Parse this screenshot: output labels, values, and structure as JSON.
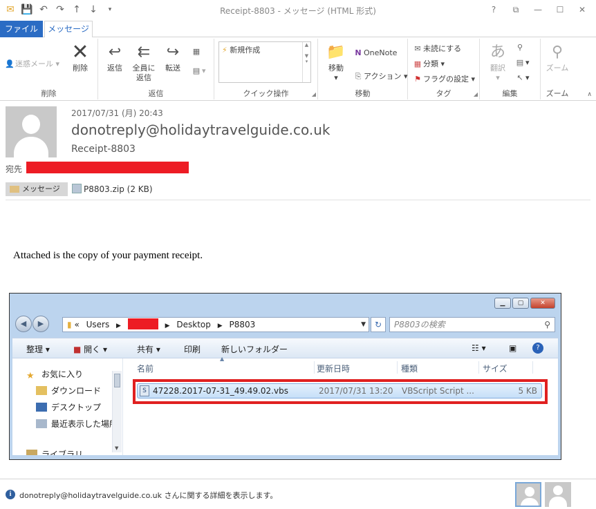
{
  "window": {
    "title": "Receipt-8803 - メッセージ (HTML 形式)",
    "controls": [
      "?",
      "⧉",
      "—",
      "☐",
      "✕"
    ]
  },
  "qat": [
    "mail-icon",
    "save-icon",
    "undo-icon",
    "redo-icon",
    "up-icon",
    "down-icon",
    "customize-icon"
  ],
  "tabs": {
    "file": "ファイル",
    "message": "メッセージ"
  },
  "ribbon": {
    "delete_group": {
      "label": "削除",
      "junk": "迷惑メール",
      "delete": "削除"
    },
    "reply_group": {
      "label": "返信",
      "reply": "返信",
      "reply_all_1": "全員に",
      "reply_all_2": "返信",
      "forward": "転送"
    },
    "quick_group": {
      "label": "クイック操作",
      "new": "新規作成"
    },
    "move_group": {
      "label": "移動",
      "move": "移動",
      "onenote": "OneNote",
      "action": "アクション"
    },
    "tag_group": {
      "label": "タグ",
      "unread": "未読にする",
      "categorize": "分類",
      "flag": "フラグの設定"
    },
    "edit_group": {
      "label": "編集",
      "translate": "翻訳"
    },
    "zoom_group": {
      "label": "ズーム",
      "zoom": "ズーム"
    }
  },
  "message": {
    "date": "2017/07/31 (月) 20:43",
    "sender": "donotreply@holidaytravelguide.co.uk",
    "subject": "Receipt-8803",
    "to_label": "宛先",
    "message_button": "メッセージ",
    "attachment": "P8803.zip (2 KB)",
    "body": "Attached is the copy of your payment receipt."
  },
  "explorer": {
    "breadcrumb": {
      "lead": "«",
      "users": "Users",
      "desktop": "Desktop",
      "folder": "P8803"
    },
    "search_placeholder": "P8803の検索",
    "toolbar": {
      "organize": "整理",
      "open": "開く",
      "share": "共有",
      "print": "印刷",
      "new_folder": "新しいフォルダー"
    },
    "nav": {
      "favorites": "お気に入り",
      "downloads": "ダウンロード",
      "desktop": "デスクトップ",
      "recent": "最近表示した場所",
      "libraries": "ライブラリ"
    },
    "columns": {
      "name": "名前",
      "modified": "更新日時",
      "type": "種類",
      "size": "サイズ"
    },
    "file": {
      "name": "47228.2017-07-31_49.49.02.vbs",
      "modified": "2017/07/31 13:20",
      "type": "VBScript Script ...",
      "size": "5 KB"
    }
  },
  "footer": {
    "text": "donotreply@holidaytravelguide.co.uk さんに関する詳細を表示します。"
  },
  "colors": {
    "accent": "#2b6cc4",
    "redaction": "#ed1c24",
    "highlight_box": "#e02020"
  }
}
